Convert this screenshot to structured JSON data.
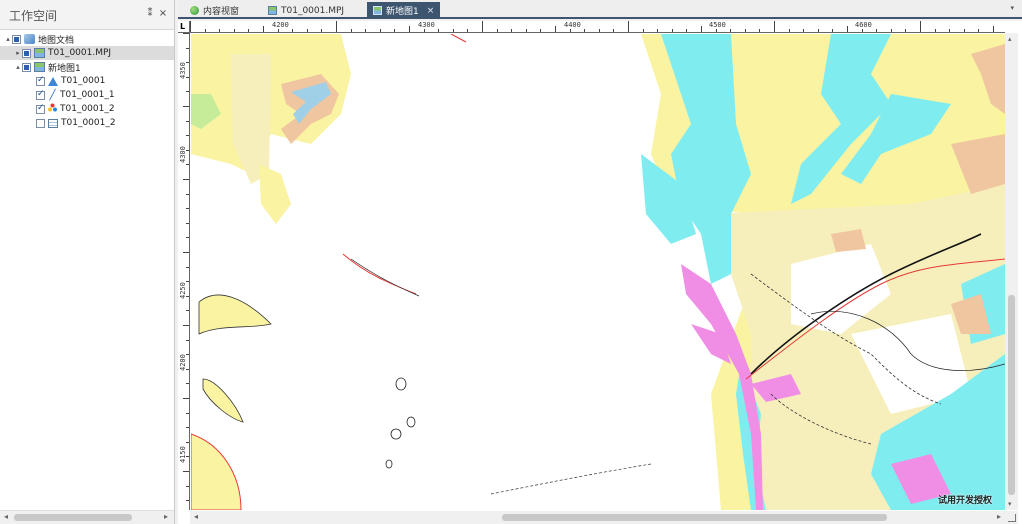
{
  "workspace": {
    "title": "工作空间",
    "pin_glyph": "⁑",
    "close_glyph": "×",
    "tree": [
      {
        "label": "地图文档",
        "level": 0,
        "twisty": "▴",
        "check": "partial",
        "icon": "doc-icon"
      },
      {
        "label": "T01_0001.MPJ",
        "level": 1,
        "twisty": "▸",
        "check": "partial",
        "icon": "map-icon",
        "selected": true
      },
      {
        "label": "新地图1",
        "level": 1,
        "twisty": "▴",
        "check": "partial",
        "icon": "map-icon"
      },
      {
        "label": "T01_0001",
        "level": 2,
        "twisty": "",
        "check": "checked",
        "icon": "region-layer-icon"
      },
      {
        "label": "T01_0001_1",
        "level": 2,
        "twisty": "",
        "check": "checked",
        "icon": "line-layer-icon"
      },
      {
        "label": "T01_0001_2",
        "level": 2,
        "twisty": "",
        "check": "checked",
        "icon": "point-layer-icon"
      },
      {
        "label": "T01_0001_2",
        "level": 2,
        "twisty": "",
        "check": "unchecked",
        "icon": "table-layer-icon"
      }
    ]
  },
  "tabs": [
    {
      "label": "内容视窗",
      "icon": "globe-icon",
      "active": false
    },
    {
      "label": "T01_0001.MPJ",
      "icon": "map-icon",
      "active": false
    },
    {
      "label": "新地图1",
      "icon": "map-icon",
      "active": true,
      "close": "×"
    }
  ],
  "tab_dropdown": "▾",
  "ruler": {
    "corner": "L",
    "top_labels": [
      "4200",
      "4300",
      "4400",
      "4500",
      "4600"
    ],
    "left_labels": [
      "4350",
      "4300",
      "4250",
      "4200",
      "4150"
    ]
  },
  "watermark": "试用开发授权",
  "colors": {
    "water": "#7fecef",
    "yellow": "#f9f3a2",
    "pale_yellow": "#f6efbc",
    "pink": "#f08ee6",
    "tan": "#efc6a0",
    "green": "#c6ec9a",
    "active_tab": "#3e5570"
  }
}
